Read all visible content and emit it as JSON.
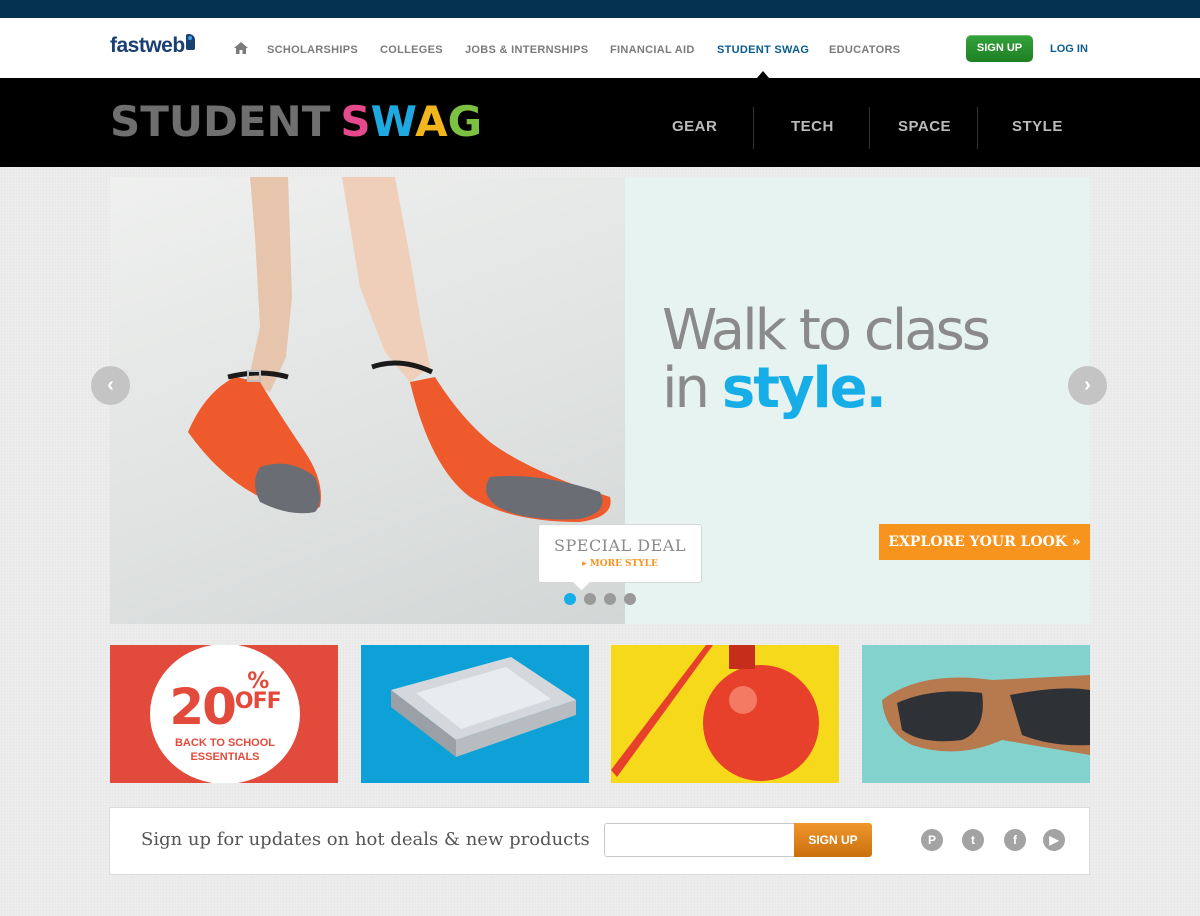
{
  "header": {
    "logo": "fastweb",
    "nav": [
      {
        "label": "SCHOLARSHIPS"
      },
      {
        "label": "COLLEGES"
      },
      {
        "label": "JOBS & INTERNSHIPS"
      },
      {
        "label": "FINANCIAL AID"
      },
      {
        "label": "STUDENT SWAG"
      },
      {
        "label": "EDUCATORS"
      }
    ],
    "active_nav": "STUDENT SWAG",
    "signup_label": "SIGN UP",
    "login_label": "LOG IN"
  },
  "banner": {
    "title_part1": "STUDENT",
    "title_part2_letters": [
      "S",
      "W",
      "A",
      "G"
    ],
    "categories": [
      "GEAR",
      "TECH",
      "SPACE",
      "STYLE"
    ]
  },
  "hero": {
    "headline_line1": "Walk to class",
    "headline_line2_prefix": "in ",
    "headline_line2_emphasis": "style.",
    "cta_label": "EXPLORE YOUR LOOK »",
    "deal_title": "SPECIAL DEAL",
    "deal_link": "MORE STYLE",
    "slide_count": 4,
    "active_slide": 1
  },
  "tiles": {
    "promo_number": "20",
    "promo_percent": "%",
    "promo_off": "OFF",
    "promo_line1": "BACK TO SCHOOL",
    "promo_line2": "ESSENTIALS"
  },
  "newsletter": {
    "text": "Sign up for updates on hot deals & new products",
    "input_placeholder": "",
    "button_label": "SIGN UP",
    "social_icons": [
      "pinterest-icon",
      "twitter-icon",
      "facebook-icon",
      "youtube-icon"
    ]
  },
  "colors": {
    "top_strip": "#05324f",
    "active_nav": "#0a5c8f",
    "signup_green": "#2a9631",
    "cta_orange": "#f7941d",
    "accent_blue": "#17aee8"
  }
}
